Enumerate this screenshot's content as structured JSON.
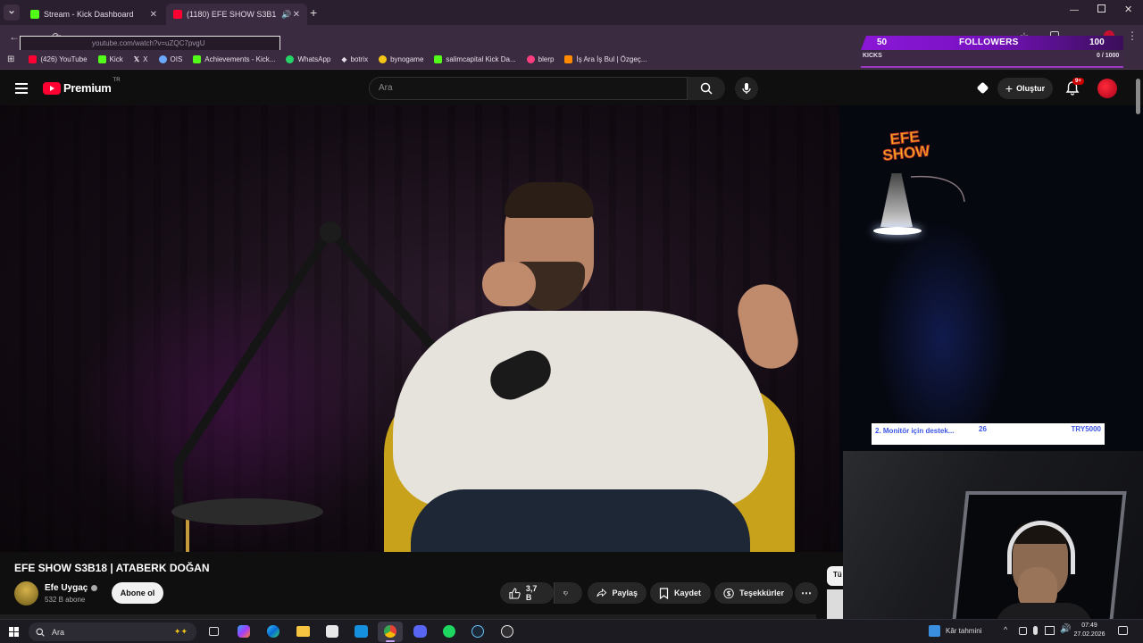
{
  "browser": {
    "tabs": [
      {
        "title": "Stream - Kick Dashboard",
        "color": "#53fc18"
      },
      {
        "title": "(1180) EFE SHOW S3B18 | A",
        "color": "#ff0033"
      }
    ],
    "url": "youtube.com/watch?v=uZQC7pvgU",
    "bookmarks": [
      {
        "label": "(426) YouTube",
        "color": "#ff0033"
      },
      {
        "label": "Kick",
        "color": "#53fc18"
      },
      {
        "label": "X",
        "color": "#ffffff"
      },
      {
        "label": "OIS",
        "color": "#6aa9ff"
      },
      {
        "label": "Achievements - Kick...",
        "color": "#53fc18"
      },
      {
        "label": "WhatsApp",
        "color": "#25d366"
      },
      {
        "label": "botrix",
        "color": "#ffffff"
      },
      {
        "label": "bynogame",
        "color": "#f5c518"
      },
      {
        "label": "salimcapital Kick Da...",
        "color": "#53fc18"
      },
      {
        "label": "blerp",
        "color": "#ff3e7f"
      },
      {
        "label": "İş Ara İş Bul | Özgeç...",
        "color": "#ff8a00"
      }
    ]
  },
  "overlay": {
    "followers_current": "50",
    "followers_label": "FOLLOWERS",
    "followers_goal": "100",
    "kicks_label": "KICKS",
    "kicks_progress": "0 / 1000",
    "donation_text": "2. Monitör için destek...",
    "donation_count": "26",
    "donation_amount": "TRY5000"
  },
  "youtube": {
    "logo_text": "Premium",
    "logo_sup": "TR",
    "search_placeholder": "Ara",
    "create_label": "Oluştur",
    "notif_badge": "9+",
    "brand_color": "#ff0033",
    "video_title": "EFE SHOW S3B18 | ATABERK DOĞAN",
    "watermark_line1": "EFE",
    "watermark_line2": "SHOW",
    "channel_name": "Efe Uygaç",
    "subscribers": "532 B abone",
    "subscribe_label": "Abone ol",
    "like_count": "3,7 B",
    "share_label": "Paylaş",
    "save_label": "Kaydet",
    "thanks_label": "Teşekkürler",
    "side_chip": "Tü"
  },
  "taskbar": {
    "search_placeholder": "Ara",
    "weather": "Kâr tahmini",
    "time": "07:49",
    "date": "27.02.2026"
  }
}
